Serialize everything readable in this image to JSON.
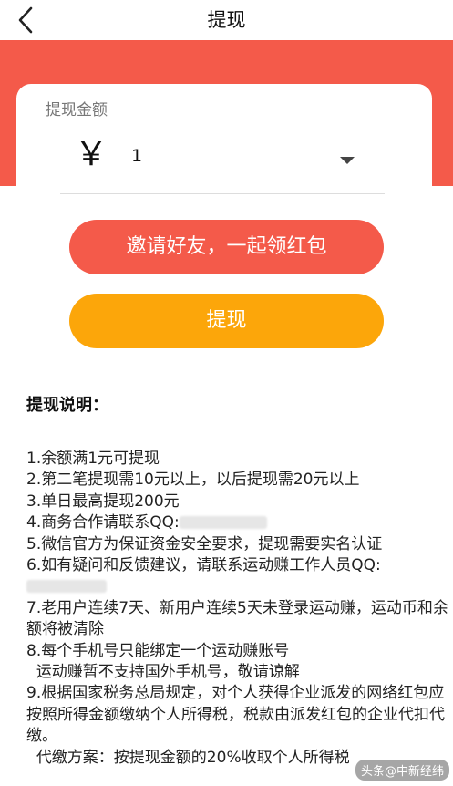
{
  "nav": {
    "title": "提现"
  },
  "card": {
    "label": "提现金额",
    "currency_symbol": "￥",
    "amount": "1"
  },
  "buttons": {
    "invite": "邀请好友，一起领红包",
    "withdraw": "提现"
  },
  "explanation": {
    "title": "提现说明：",
    "items": [
      "1.余额满1元可提现",
      "2.第二笔提现需10元以上，以后提现需20元以上",
      "3.单日最高提现200元",
      "4.商务合作请联系QQ:",
      "5.微信官方为保证资金安全要求，提现需要实名认证",
      "6.如有疑问和反馈建议，请联系运动赚工作人员QQ:",
      "7.老用户连续7天、新用户连续5天未登录运动赚，运动币和余额将被清除",
      "8.每个手机号只能绑定一个运动赚账号",
      "  运动赚暂不支持国外手机号，敬请谅解",
      "9.根据国家税务总局规定，对个人获得企业派发的网络红包应按照所得金额缴纳个人所得税，税款由派发红包的企业代扣代缴。",
      "  代缴方案：按提现金额的20%收取个人所得税"
    ]
  },
  "watermark": "头条@中新经纬",
  "colors": {
    "brand_red": "#f45a4a",
    "orange": "#fca60a"
  }
}
